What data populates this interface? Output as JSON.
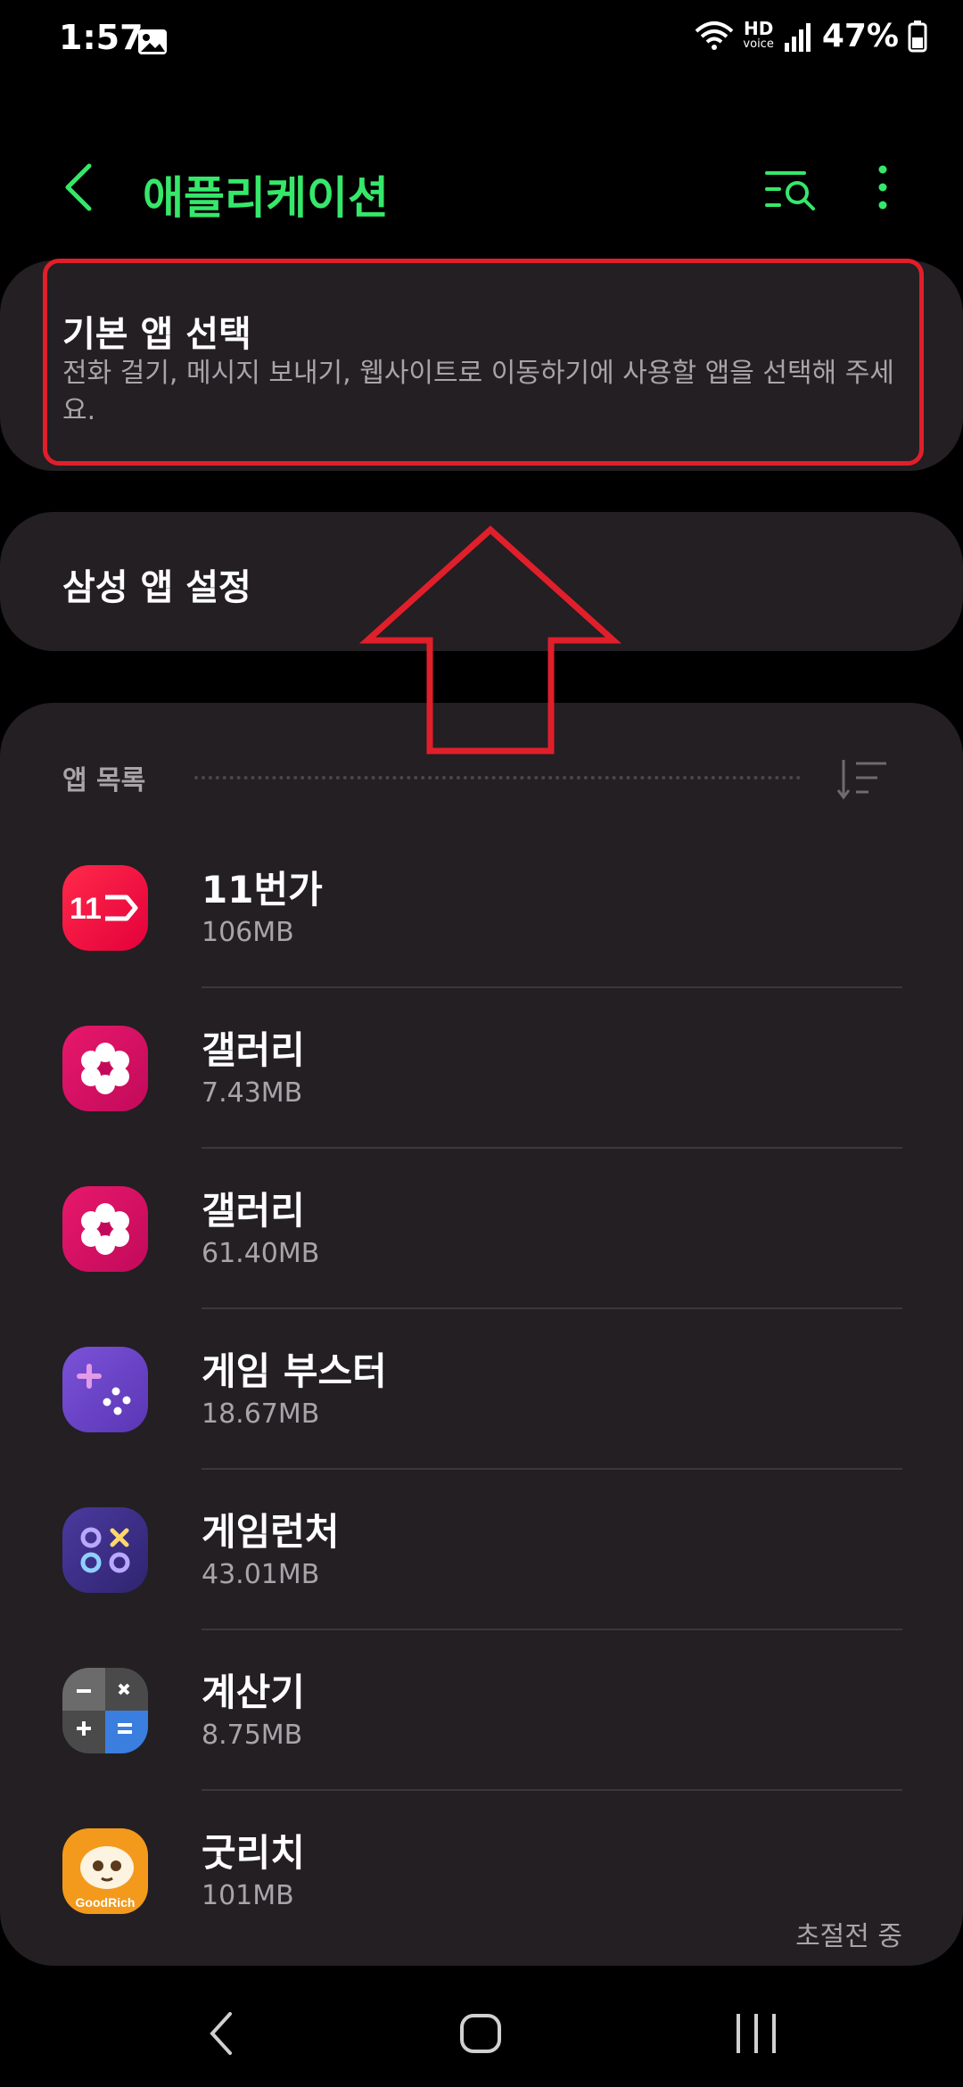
{
  "status_bar": {
    "time": "1:57",
    "hd_label": "HD",
    "voice_label": "voice",
    "battery": "47%"
  },
  "appbar": {
    "title": "애플리케이션"
  },
  "default_apps": {
    "title": "기본 앱 선택",
    "description": "전화 걸기, 메시지 보내기, 웹사이트로 이동하기에 사용할 앱을 선택해 주세요."
  },
  "samsung_settings": {
    "title": "삼성 앱 설정"
  },
  "app_list": {
    "header": "앱 목록",
    "items": [
      {
        "name": "11번가",
        "size": "106MB",
        "icon": "11st-icon",
        "icon_text": "11"
      },
      {
        "name": "갤러리",
        "size": "7.43MB",
        "icon": "gallery-icon"
      },
      {
        "name": "갤러리",
        "size": "61.40MB",
        "icon": "gallery-icon"
      },
      {
        "name": "게임 부스터",
        "size": "18.67MB",
        "icon": "game-booster-icon"
      },
      {
        "name": "게임런처",
        "size": "43.01MB",
        "icon": "game-launcher-icon"
      },
      {
        "name": "계산기",
        "size": "8.75MB",
        "icon": "calculator-icon"
      },
      {
        "name": "굿리치",
        "size": "101MB",
        "icon": "goodrich-icon",
        "icon_text": "GoodRich"
      }
    ],
    "footer_note": "초절전 중"
  },
  "colors": {
    "accent": "#35e86a",
    "highlight": "#e01f2b",
    "card": "#231f23"
  }
}
